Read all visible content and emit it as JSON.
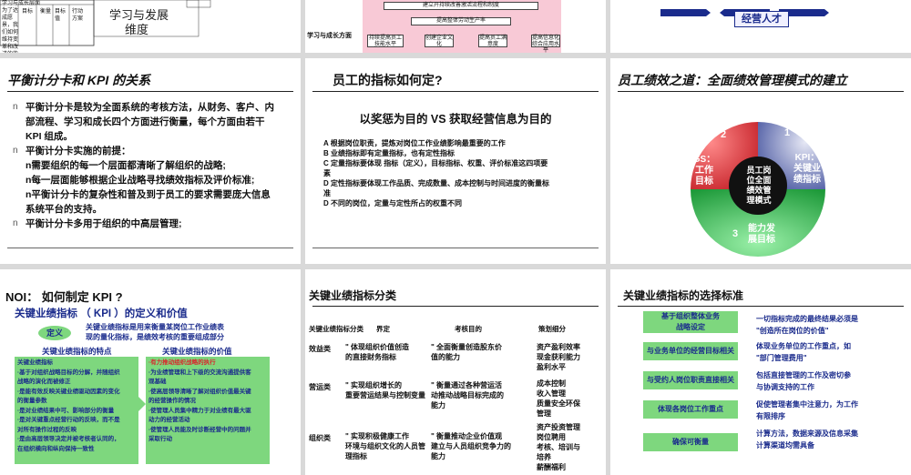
{
  "slide1": {
    "table_labels": [
      "学习与成长层面",
      "为了达成愿景，我们如何维持变革和改进的能力？",
      "目标",
      "衡量",
      "目标值",
      "行动方案"
    ],
    "caption_line1": "学习与发展",
    "caption_line2": "维度"
  },
  "slide2": {
    "label_left": "学习与成长方面",
    "row1": "建立开持续改善激活流程和制度",
    "row2": "提高整体劳动生产率",
    "boxes": [
      "持续提高员工技能水平",
      "创建企业文化",
      "提高员工满意度",
      "提高信息化综合应用水平"
    ]
  },
  "slide3": {
    "box": "经营人才"
  },
  "slide4": {
    "title": "平衡计分卡和 KPI 的关系",
    "bullets": [
      {
        "mark": "n",
        "lines": [
          "平衡计分卡是较为全面系统的考核方法，从财务、客户、内",
          "部流程、学习和成长四个方面进行衡量，每个方面由若干",
          "KPI 组成。"
        ]
      },
      {
        "mark": "n",
        "lines": [
          "平衡计分卡实施的前提："
        ]
      },
      {
        "mark": "",
        "lines": [
          "n需要组织的每一个层面都清晰了解组织的战略;"
        ]
      },
      {
        "mark": "",
        "lines": [
          "n每一层面能够根据企业战略寻找绩效指标及评价标准;"
        ]
      },
      {
        "mark": "",
        "lines": [
          "n平衡计分卡的复杂性和普及到于员工的要求需要庞大信息",
          "系统平台的支持。"
        ]
      },
      {
        "mark": "n",
        "lines": [
          "平衡计分卡多用于组织的中高层管理;"
        ]
      }
    ]
  },
  "slide5": {
    "title": "员工的指标如何定?",
    "subtitle": "以奖惩为目的 VS 获取经营信息为目的",
    "lines": [
      "A  根据岗位职责，提炼对岗位工作业绩影响最重要的工作",
      "B  业绩指标即有定量指标，也有定性指标",
      "C 定量指标要体现 指标（定义），目标指标、权重、评价标准这四项要",
      "素",
      "D 定性指标要体现工作品质、完成数量、成本控制与时间进度的衡量标",
      "准",
      "D 不同的岗位，定量与定性所占的权重不同"
    ]
  },
  "slide6": {
    "title": "员工绩效之道：全面绩效管理模式的建立",
    "center_lines": [
      "员工岗",
      "位全面",
      "绩效管",
      "理模式"
    ],
    "seg1_num": "1",
    "seg1_lines": [
      "KPI：",
      "关键业",
      "绩指标"
    ],
    "seg2_num": "2",
    "seg2_lines": [
      "GS：",
      "工作",
      "目标"
    ],
    "seg3_num": "3",
    "seg3_lines": [
      "能力发",
      "展目标"
    ],
    "colors": {
      "red": "#d9262c",
      "blue": "#3c4b9a",
      "green": "#2fb24a",
      "center": "#111111"
    }
  },
  "slide7": {
    "title": "NOI：  如何制定 KPI ?",
    "subtitle": "关键业绩指标 （ KPI ）的定义和价值",
    "def_label": "定义",
    "def_text_lines": [
      "关键业绩指标是用来衡量某岗位工作业绩表",
      "现的量化指标，是绩效考核的重要组成部分"
    ],
    "features_title": "关键业绩指标的特点",
    "value_title": "关键业绩指标的价值",
    "features": [
      "关键业绩指标",
      "·基于对组织战略目标的分解，并随组织",
      "  战略的演化而被修正",
      "·是能有效反映关键业绩驱动因素的变化",
      "  的衡量参数",
      "·是对业绩结果中可、影响部分的衡量",
      "·是对关键重点经营行动的反映，而不是",
      "  对所有操作过程的反映",
      "·是由高层领导决定并被考核者认同的，",
      "  在组织横向和纵向保持一致性"
    ],
    "values_first": "·有力推动组织战略的执行",
    "values": [
      "·为业绩管理和上下级的交流沟通提供客",
      "  观基础",
      "·使高层领导清晰了解对组织价值最关键",
      "  的经营操作的情况",
      "·使管理人员集中精力于对业绩有最大驱",
      "  动力的经营活动",
      "·使管理人员能及时诊断经营中的问题并",
      "  采取行动"
    ]
  },
  "slide8": {
    "title": "关键业绩指标分类",
    "headers": [
      "关键业绩指标分类",
      "界定",
      "考核目的",
      "策划细分"
    ],
    "rows": [
      {
        "category": "效益类",
        "def": [
          "\"    体现组织价值创造",
          "的直接财务指标"
        ],
        "purpose": [
          "\"    全面衡量创造股东价",
          "值的能力"
        ],
        "detail": [
          "资产盈利效率",
          "现金获利能力",
          "盈利水平"
        ]
      },
      {
        "category": "营运类",
        "def": [
          "\"    实现组织增长的",
          "重要营运结果与控制变量"
        ],
        "purpose": [
          "\"    衡量通过各种营运活",
          "动推动战略目标完成的",
          "能力"
        ],
        "detail": [
          "成本控制",
          "收入管理",
          "质量安全环保",
          "管理"
        ]
      },
      {
        "category": "组织类",
        "def": [
          "\"    实现积极健康工作",
          "环境与组织文化的人员管",
          "理指标"
        ],
        "purpose": [
          "\"    衡量推动企业价值观",
          "建立与人员组织竞争力的",
          "能力"
        ],
        "detail": [
          "资产投资管理",
          "岗位聘用",
          "考核、培训与",
          "培养",
          "薪酬福利"
        ]
      }
    ]
  },
  "slide9": {
    "title": "关键业绩指标的选择标准",
    "items": [
      {
        "label_lines": [
          "基于组织整体业务",
          "战略设定"
        ],
        "desc_lines": [
          "一切指标完成的最终结果必须是",
          "\"创造所在岗位的价值\""
        ]
      },
      {
        "label_lines": [
          "与业务单位的经营目标相关"
        ],
        "desc_lines": [
          "体现业务单位的工作重点，如",
          "\"部门管理费用\""
        ]
      },
      {
        "label_lines": [
          "与受约人岗位职责直接相关"
        ],
        "desc_lines": [
          "包括直接管理的工作及密切参",
          "与协调支持的工作"
        ]
      },
      {
        "label_lines": [
          "体现各岗位工作重点"
        ],
        "desc_lines": [
          "促使管理者集中注意力，为工作",
          "有限排序"
        ]
      },
      {
        "label_lines": [
          "确保可衡量"
        ],
        "desc_lines": [
          "计算方法，数据来源及信息采集",
          "计算渠道均需具备"
        ]
      }
    ]
  }
}
